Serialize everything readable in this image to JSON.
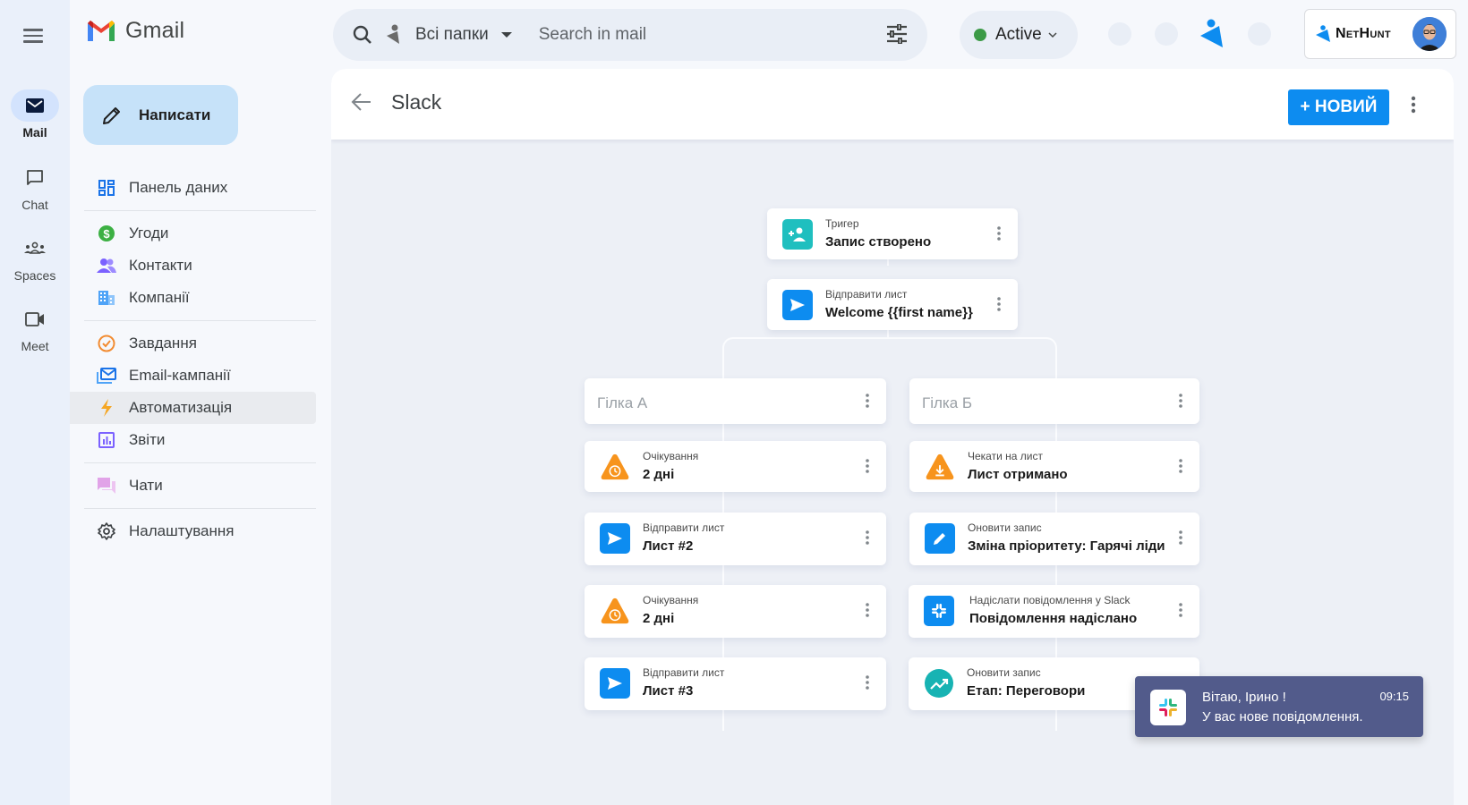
{
  "app": {
    "name": "Gmail"
  },
  "rail": {
    "items": [
      {
        "label": "Mail",
        "icon": "mail-icon",
        "active": true
      },
      {
        "label": "Chat",
        "icon": "chat-icon"
      },
      {
        "label": "Spaces",
        "icon": "spaces-icon"
      },
      {
        "label": "Meet",
        "icon": "meet-icon"
      }
    ]
  },
  "compose": {
    "label": "Написати"
  },
  "nav": {
    "items": [
      {
        "label": "Панель даних",
        "icon": "dashboard-icon",
        "color": "#1a73e8"
      },
      {
        "label": "Угоди",
        "icon": "deals-dollar-icon",
        "color": "#34a853"
      },
      {
        "label": "Контакти",
        "icon": "contacts-icon",
        "color": "#7b61ff"
      },
      {
        "label": "Компанії",
        "icon": "companies-icon",
        "color": "#4fa3f7"
      },
      {
        "label": "Завдання",
        "icon": "tasks-check-icon",
        "color": "#f28b30"
      },
      {
        "label": "Email-кампанії",
        "icon": "email-campaigns-icon",
        "color": "#1a73e8"
      },
      {
        "label": "Автоматизація",
        "icon": "automation-bolt-icon",
        "color": "#f5a623",
        "active": true
      },
      {
        "label": "Звіти",
        "icon": "reports-icon",
        "color": "#7b61ff"
      },
      {
        "label": "Чати",
        "icon": "chats-icon",
        "color": "#e1a3e8"
      },
      {
        "label": "Налаштування",
        "icon": "settings-gear-icon",
        "color": "#3c4043"
      }
    ]
  },
  "search": {
    "folder": "Всі папки",
    "placeholder": "Search in mail"
  },
  "status": {
    "label": "Active",
    "color": "#3c9a47"
  },
  "brand": {
    "name": "NetHunt",
    "accent": "#0d8cf0"
  },
  "panel": {
    "title": "Slack",
    "new_button": "+ НОВИЙ"
  },
  "flow": {
    "trigger": {
      "sub": "Тригер",
      "main": "Запис створено"
    },
    "send_welcome": {
      "sub": "Відправити лист",
      "main": "Welcome {{first name}}"
    },
    "branch_a": {
      "label": "Гілка А",
      "steps": [
        {
          "sub": "Очікування",
          "main": "2 дні",
          "icon": "wait-clock-icon"
        },
        {
          "sub": "Відправити лист",
          "main": "Лист #2",
          "icon": "send-icon"
        },
        {
          "sub": "Очікування",
          "main": "2 дні",
          "icon": "wait-clock-icon"
        },
        {
          "sub": "Відправити лист",
          "main": "Лист #3",
          "icon": "send-icon"
        }
      ]
    },
    "branch_b": {
      "label": "Гілка Б",
      "steps": [
        {
          "sub": "Чекати на лист",
          "main": "Лист отримано",
          "icon": "wait-email-icon"
        },
        {
          "sub": "Оновити запис",
          "main": "Зміна пріоритету: Гарячі ліди",
          "icon": "edit-pencil-icon"
        },
        {
          "sub": "Надіслати повідомлення у Slack",
          "main": "Повідомлення надіслано",
          "icon": "slack-icon"
        },
        {
          "sub": "Оновити запис",
          "main": "Етап: Переговори",
          "icon": "trend-up-icon"
        }
      ]
    }
  },
  "toast": {
    "title": "Вітаю, Ірино !",
    "message": "У вас нове повідомлення.",
    "time": "09:15"
  }
}
